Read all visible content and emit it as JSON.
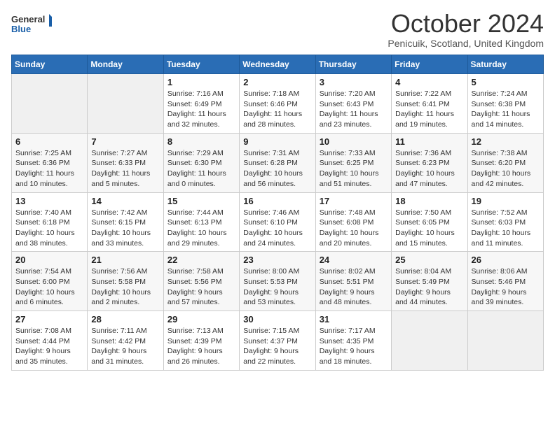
{
  "header": {
    "logo_line1": "General",
    "logo_line2": "Blue",
    "month": "October 2024",
    "location": "Penicuik, Scotland, United Kingdom"
  },
  "weekdays": [
    "Sunday",
    "Monday",
    "Tuesday",
    "Wednesday",
    "Thursday",
    "Friday",
    "Saturday"
  ],
  "weeks": [
    [
      {
        "day": "",
        "info": ""
      },
      {
        "day": "",
        "info": ""
      },
      {
        "day": "1",
        "info": "Sunrise: 7:16 AM\nSunset: 6:49 PM\nDaylight: 11 hours and 32 minutes."
      },
      {
        "day": "2",
        "info": "Sunrise: 7:18 AM\nSunset: 6:46 PM\nDaylight: 11 hours and 28 minutes."
      },
      {
        "day": "3",
        "info": "Sunrise: 7:20 AM\nSunset: 6:43 PM\nDaylight: 11 hours and 23 minutes."
      },
      {
        "day": "4",
        "info": "Sunrise: 7:22 AM\nSunset: 6:41 PM\nDaylight: 11 hours and 19 minutes."
      },
      {
        "day": "5",
        "info": "Sunrise: 7:24 AM\nSunset: 6:38 PM\nDaylight: 11 hours and 14 minutes."
      }
    ],
    [
      {
        "day": "6",
        "info": "Sunrise: 7:25 AM\nSunset: 6:36 PM\nDaylight: 11 hours and 10 minutes."
      },
      {
        "day": "7",
        "info": "Sunrise: 7:27 AM\nSunset: 6:33 PM\nDaylight: 11 hours and 5 minutes."
      },
      {
        "day": "8",
        "info": "Sunrise: 7:29 AM\nSunset: 6:30 PM\nDaylight: 11 hours and 0 minutes."
      },
      {
        "day": "9",
        "info": "Sunrise: 7:31 AM\nSunset: 6:28 PM\nDaylight: 10 hours and 56 minutes."
      },
      {
        "day": "10",
        "info": "Sunrise: 7:33 AM\nSunset: 6:25 PM\nDaylight: 10 hours and 51 minutes."
      },
      {
        "day": "11",
        "info": "Sunrise: 7:36 AM\nSunset: 6:23 PM\nDaylight: 10 hours and 47 minutes."
      },
      {
        "day": "12",
        "info": "Sunrise: 7:38 AM\nSunset: 6:20 PM\nDaylight: 10 hours and 42 minutes."
      }
    ],
    [
      {
        "day": "13",
        "info": "Sunrise: 7:40 AM\nSunset: 6:18 PM\nDaylight: 10 hours and 38 minutes."
      },
      {
        "day": "14",
        "info": "Sunrise: 7:42 AM\nSunset: 6:15 PM\nDaylight: 10 hours and 33 minutes."
      },
      {
        "day": "15",
        "info": "Sunrise: 7:44 AM\nSunset: 6:13 PM\nDaylight: 10 hours and 29 minutes."
      },
      {
        "day": "16",
        "info": "Sunrise: 7:46 AM\nSunset: 6:10 PM\nDaylight: 10 hours and 24 minutes."
      },
      {
        "day": "17",
        "info": "Sunrise: 7:48 AM\nSunset: 6:08 PM\nDaylight: 10 hours and 20 minutes."
      },
      {
        "day": "18",
        "info": "Sunrise: 7:50 AM\nSunset: 6:05 PM\nDaylight: 10 hours and 15 minutes."
      },
      {
        "day": "19",
        "info": "Sunrise: 7:52 AM\nSunset: 6:03 PM\nDaylight: 10 hours and 11 minutes."
      }
    ],
    [
      {
        "day": "20",
        "info": "Sunrise: 7:54 AM\nSunset: 6:00 PM\nDaylight: 10 hours and 6 minutes."
      },
      {
        "day": "21",
        "info": "Sunrise: 7:56 AM\nSunset: 5:58 PM\nDaylight: 10 hours and 2 minutes."
      },
      {
        "day": "22",
        "info": "Sunrise: 7:58 AM\nSunset: 5:56 PM\nDaylight: 9 hours and 57 minutes."
      },
      {
        "day": "23",
        "info": "Sunrise: 8:00 AM\nSunset: 5:53 PM\nDaylight: 9 hours and 53 minutes."
      },
      {
        "day": "24",
        "info": "Sunrise: 8:02 AM\nSunset: 5:51 PM\nDaylight: 9 hours and 48 minutes."
      },
      {
        "day": "25",
        "info": "Sunrise: 8:04 AM\nSunset: 5:49 PM\nDaylight: 9 hours and 44 minutes."
      },
      {
        "day": "26",
        "info": "Sunrise: 8:06 AM\nSunset: 5:46 PM\nDaylight: 9 hours and 39 minutes."
      }
    ],
    [
      {
        "day": "27",
        "info": "Sunrise: 7:08 AM\nSunset: 4:44 PM\nDaylight: 9 hours and 35 minutes."
      },
      {
        "day": "28",
        "info": "Sunrise: 7:11 AM\nSunset: 4:42 PM\nDaylight: 9 hours and 31 minutes."
      },
      {
        "day": "29",
        "info": "Sunrise: 7:13 AM\nSunset: 4:39 PM\nDaylight: 9 hours and 26 minutes."
      },
      {
        "day": "30",
        "info": "Sunrise: 7:15 AM\nSunset: 4:37 PM\nDaylight: 9 hours and 22 minutes."
      },
      {
        "day": "31",
        "info": "Sunrise: 7:17 AM\nSunset: 4:35 PM\nDaylight: 9 hours and 18 minutes."
      },
      {
        "day": "",
        "info": ""
      },
      {
        "day": "",
        "info": ""
      }
    ]
  ]
}
